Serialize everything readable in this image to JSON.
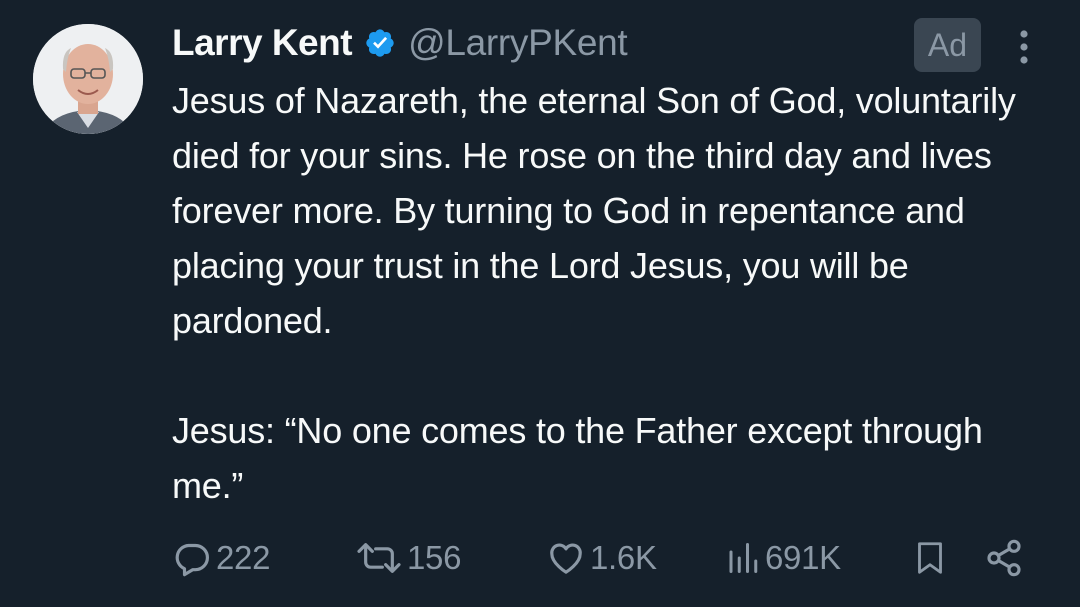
{
  "author": {
    "name": "Larry Kent",
    "handle": "@LarryPKent",
    "verified": true
  },
  "badge": "Ad",
  "tweet": {
    "text": "Jesus of Nazareth, the eternal Son of God, voluntarily died for your sins. He rose on the third day and lives forever more. By turning to God in repentance and placing your trust in the Lord Jesus, you will be pardoned.\n\nJesus: “No one comes to the Father except through me.”"
  },
  "actions": {
    "replies": "222",
    "retweets": "156",
    "likes": "1.6K",
    "views": "691K"
  },
  "colors": {
    "background": "#15202b",
    "text": "#f7f9f9",
    "secondary": "#8b98a5",
    "verified": "#1d9bf0"
  },
  "icons": [
    "verified-badge-icon",
    "more-icon",
    "reply-icon",
    "retweet-icon",
    "like-icon",
    "views-icon",
    "bookmark-icon",
    "share-icon"
  ]
}
